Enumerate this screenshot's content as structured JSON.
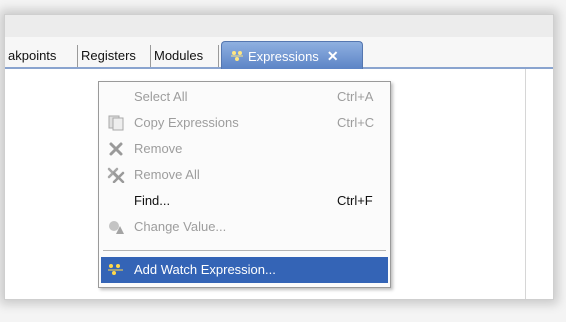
{
  "tabs": {
    "items": [
      "akpoints",
      "Registers",
      "Modules"
    ],
    "active": "Expressions",
    "close_glyph": "✕"
  },
  "menu": {
    "items": [
      {
        "label": "Select All",
        "shortcut": "Ctrl+A",
        "icon": "none",
        "state": "disabled"
      },
      {
        "label": "Copy Expressions",
        "shortcut": "Ctrl+C",
        "icon": "copy-icon",
        "state": "disabled"
      },
      {
        "label": "Remove",
        "shortcut": "",
        "icon": "remove-icon",
        "state": "disabled"
      },
      {
        "label": "Remove All",
        "shortcut": "",
        "icon": "remove-all-icon",
        "state": "disabled"
      },
      {
        "label": "Find...",
        "shortcut": "Ctrl+F",
        "icon": "none",
        "state": "enabled"
      },
      {
        "label": "Change Value...",
        "shortcut": "",
        "icon": "change-value-icon",
        "state": "disabled"
      },
      {
        "label": "Add Watch Expression...",
        "shortcut": "",
        "icon": "watch-expression-icon",
        "state": "selected"
      }
    ]
  },
  "colors": {
    "tab_active": "#5c84c6",
    "menu_selection": "#3464b6",
    "disabled_text": "#9d9d9d"
  }
}
